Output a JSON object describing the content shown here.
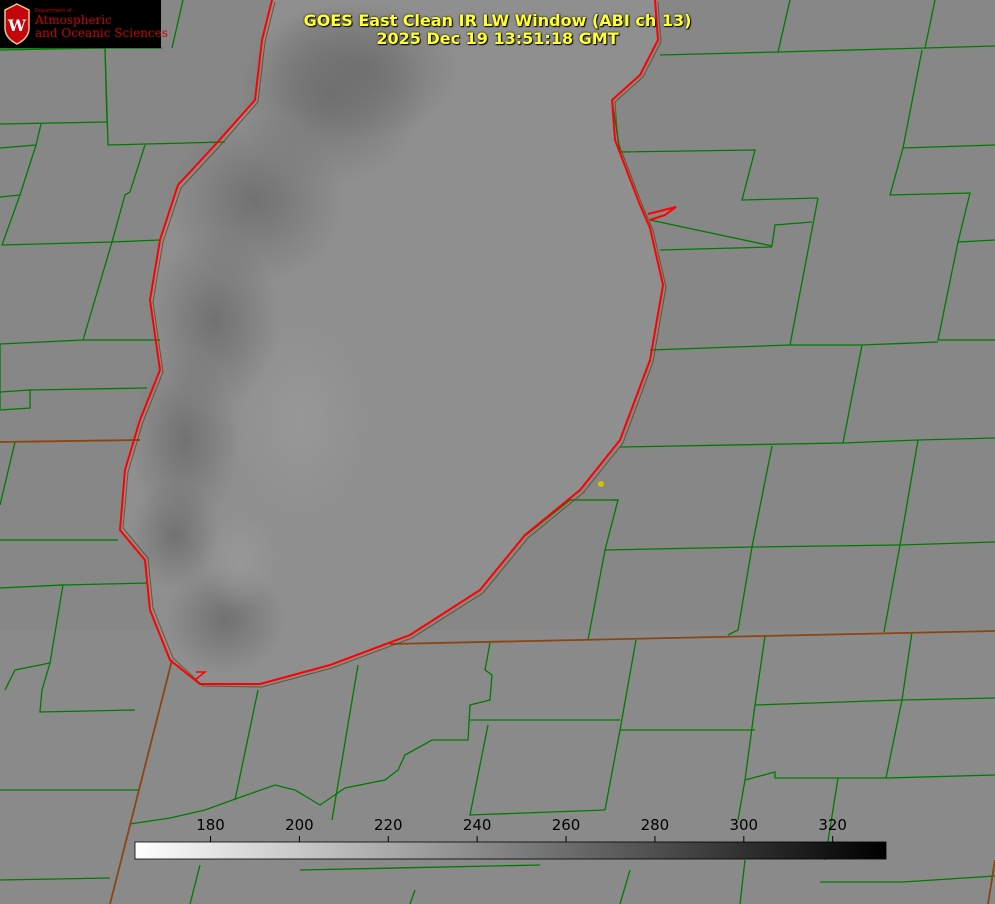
{
  "title": {
    "line1": "GOES East Clean IR LW Window (ABI ch 13)",
    "line2": "2025 Dec 19 13:51:18 GMT"
  },
  "logo": {
    "department": "Department of",
    "line1": "Atmospheric",
    "line2": "and Oceanic Sciences",
    "seal_letter": "W",
    "seal_color": "#c5050c"
  },
  "colorbar": {
    "ticks": [
      "180",
      "200",
      "220",
      "240",
      "260",
      "280",
      "300",
      "320"
    ],
    "tick_values": [
      180,
      200,
      220,
      240,
      260,
      280,
      300,
      320
    ],
    "range": [
      163,
      332
    ],
    "gradient": "white-to-black"
  },
  "colors": {
    "title": "#ffff33",
    "shoreline": "#ff0000",
    "boundaries": "#007a00",
    "state_border": "#8b4513",
    "marker": "#d4c200"
  }
}
